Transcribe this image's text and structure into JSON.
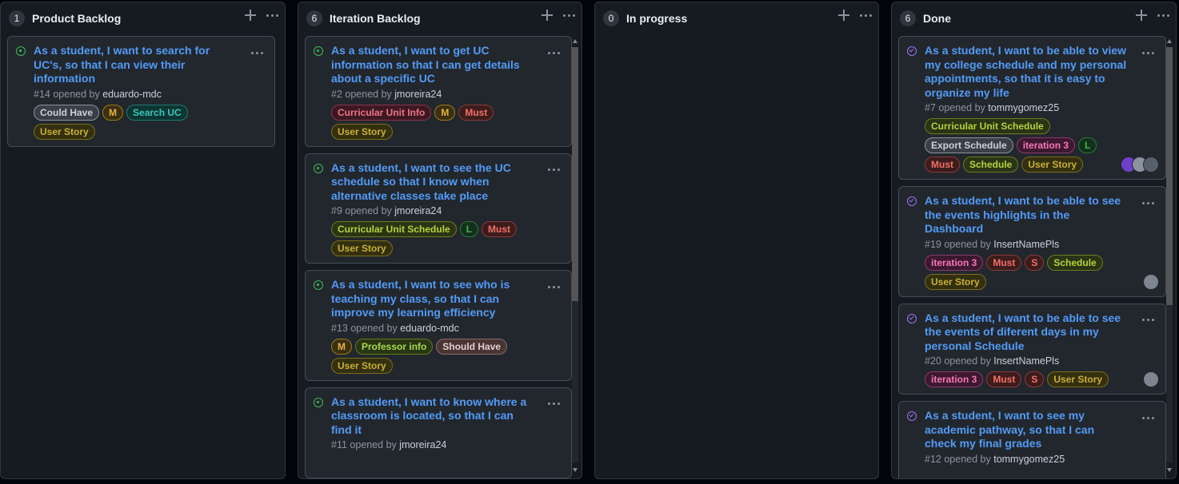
{
  "columns": [
    {
      "count": "1",
      "title": "Product Backlog",
      "cards": [
        {
          "status": "open",
          "title": "As a student, I want to search for UC's, so that I can view their information",
          "number": "#14",
          "opened_by": "opened by",
          "author": "eduardo-mdc",
          "labels": [
            {
              "text": "Could Have",
              "color": "#c9d1d9",
              "bg": "#3a3f46",
              "border": "#8b949e"
            },
            {
              "text": "M",
              "color": "#e3b341",
              "bg": "#3b3014",
              "border": "#9e7a14"
            },
            {
              "text": "Search UC",
              "color": "#39c5bb",
              "bg": "#0d3532",
              "border": "#1d7a72"
            },
            {
              "text": "User Story",
              "color": "#c9b037",
              "bg": "#34300f",
              "border": "#7a6d1d"
            }
          ],
          "avatars": []
        }
      ]
    },
    {
      "count": "6",
      "title": "Iteration Backlog",
      "cards": [
        {
          "status": "open",
          "title": "As a student, I want to get UC information so that I can get details about a specific UC",
          "number": "#2",
          "opened_by": "opened by",
          "author": "jmoreira24",
          "labels": [
            {
              "text": "Curricular Unit Info",
              "color": "#f0738a",
              "bg": "#3d1822",
              "border": "#8c3446"
            },
            {
              "text": "M",
              "color": "#e3b341",
              "bg": "#3b3014",
              "border": "#9e7a14"
            },
            {
              "text": "Must",
              "color": "#f47067",
              "bg": "#3d1c1c",
              "border": "#8c3a3a"
            },
            {
              "text": "User Story",
              "color": "#c9b037",
              "bg": "#34300f",
              "border": "#7a6d1d"
            }
          ],
          "avatars": []
        },
        {
          "status": "open",
          "title": "As a student, I want to see the UC schedule so that I know when alternative classes take place",
          "number": "#9",
          "opened_by": "opened by",
          "author": "jmoreira24",
          "labels": [
            {
              "text": "Curricular Unit Schedule",
              "color": "#b4d43d",
              "bg": "#2b3414",
              "border": "#6b7d1f"
            },
            {
              "text": "L",
              "color": "#3fb950",
              "bg": "#12301a",
              "border": "#2a7a3a"
            },
            {
              "text": "Must",
              "color": "#f47067",
              "bg": "#3d1c1c",
              "border": "#8c3a3a"
            },
            {
              "text": "User Story",
              "color": "#c9b037",
              "bg": "#34300f",
              "border": "#7a6d1d"
            }
          ],
          "avatars": []
        },
        {
          "status": "open",
          "title": "As a student, I want to see who is teaching my class, so that I can improve my learning efficiency",
          "number": "#13",
          "opened_by": "opened by",
          "author": "eduardo-mdc",
          "labels": [
            {
              "text": "M",
              "color": "#e3b341",
              "bg": "#3b3014",
              "border": "#9e7a14"
            },
            {
              "text": "Professor info",
              "color": "#a8d84e",
              "bg": "#283614",
              "border": "#5f7f1f"
            },
            {
              "text": "Should Have",
              "color": "#e6d0d0",
              "bg": "#4a3535",
              "border": "#8a6a6a"
            },
            {
              "text": "User Story",
              "color": "#c9b037",
              "bg": "#34300f",
              "border": "#7a6d1d"
            }
          ],
          "avatars": []
        },
        {
          "status": "open",
          "title": "As a student, I want to know where a classroom is located, so that I can find it",
          "number": "#11",
          "opened_by": "opened by",
          "author": "jmoreira24",
          "labels": [],
          "avatars": []
        }
      ]
    },
    {
      "count": "0",
      "title": "In progress",
      "cards": []
    },
    {
      "count": "6",
      "title": "Done",
      "cards": [
        {
          "status": "done",
          "title": "As a student, I want to be able to view my college schedule and my personal appointments, so that it is easy to organize my life",
          "number": "#7",
          "opened_by": "opened by",
          "author": "tommygomez25",
          "labels": [
            {
              "text": "Curricular Unit Schedule",
              "color": "#b4d43d",
              "bg": "#2b3414",
              "border": "#6b7d1f"
            },
            {
              "text": "Export Schedule",
              "color": "#c9d1d9",
              "bg": "#3a3f46",
              "border": "#8b949e"
            },
            {
              "text": "iteration 3",
              "color": "#f778ba",
              "bg": "#3d1830",
              "border": "#8c3a6c"
            },
            {
              "text": "L",
              "color": "#3fb950",
              "bg": "#12301a",
              "border": "#2a7a3a"
            },
            {
              "text": "Must",
              "color": "#f47067",
              "bg": "#3d1c1c",
              "border": "#8c3a3a"
            },
            {
              "text": "Schedule",
              "color": "#b4d43d",
              "bg": "#2b3414",
              "border": "#6b7d1f"
            },
            {
              "text": "User Story",
              "color": "#c9b037",
              "bg": "#34300f",
              "border": "#7a6d1d"
            }
          ],
          "avatars": [
            "#6e40c9",
            "#8b949e",
            "#57606a"
          ]
        },
        {
          "status": "done",
          "title": "As a student, I want to be able to see the events highlights in the Dashboard",
          "number": "#19",
          "opened_by": "opened by",
          "author": "InsertNamePls",
          "labels": [
            {
              "text": "iteration 3",
              "color": "#f778ba",
              "bg": "#3d1830",
              "border": "#8c3a6c"
            },
            {
              "text": "Must",
              "color": "#f47067",
              "bg": "#3d1c1c",
              "border": "#8c3a3a"
            },
            {
              "text": "S",
              "color": "#f47067",
              "bg": "#3d1c1c",
              "border": "#8c3a3a"
            },
            {
              "text": "Schedule",
              "color": "#b4d43d",
              "bg": "#2b3414",
              "border": "#6b7d1f"
            },
            {
              "text": "User Story",
              "color": "#c9b037",
              "bg": "#34300f",
              "border": "#7a6d1d"
            }
          ],
          "avatars": [
            "#7d8590"
          ]
        },
        {
          "status": "done",
          "title": "As a student, I want to be able to see the events of diferent days in my personal Schedule",
          "number": "#20",
          "opened_by": "opened by",
          "author": "InsertNamePls",
          "labels": [
            {
              "text": "iteration 3",
              "color": "#f778ba",
              "bg": "#3d1830",
              "border": "#8c3a6c"
            },
            {
              "text": "Must",
              "color": "#f47067",
              "bg": "#3d1c1c",
              "border": "#8c3a3a"
            },
            {
              "text": "S",
              "color": "#f47067",
              "bg": "#3d1c1c",
              "border": "#8c3a3a"
            },
            {
              "text": "User Story",
              "color": "#c9b037",
              "bg": "#34300f",
              "border": "#7a6d1d"
            }
          ],
          "avatars": [
            "#7d8590"
          ]
        },
        {
          "status": "done",
          "title": "As a student, I want to see my academic pathway, so that I can check my final grades",
          "number": "#12",
          "opened_by": "opened by",
          "author": "tommygomez25",
          "labels": [],
          "avatars": []
        }
      ]
    }
  ]
}
